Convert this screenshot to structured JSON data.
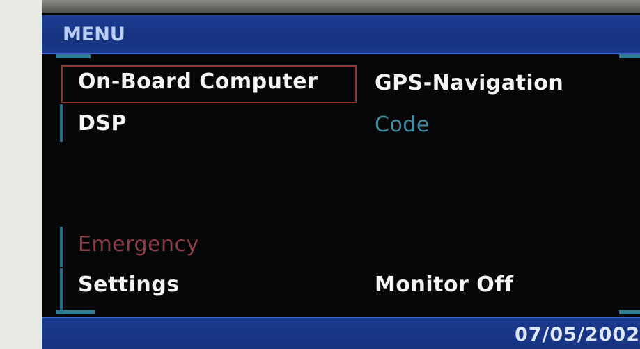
{
  "header": {
    "title": "MENU"
  },
  "menu": {
    "left": [
      {
        "label": "On-Board Computer",
        "state": "selected"
      },
      {
        "label": "DSP",
        "state": "normal"
      },
      {
        "label": "Emergency",
        "state": "disabled"
      },
      {
        "label": "Settings",
        "state": "normal"
      }
    ],
    "right": [
      {
        "label": "GPS-Navigation",
        "state": "normal"
      },
      {
        "label": "Code",
        "state": "disabled"
      },
      {
        "label": "Monitor Off",
        "state": "normal"
      }
    ]
  },
  "footer": {
    "date": "07/05/2002"
  },
  "colors": {
    "header_bg": "#16337f",
    "selection_border": "#8d3a33",
    "disabled_red": "#8c3f46",
    "disabled_blue": "#3f8ca3",
    "text": "#f4f4f2"
  }
}
